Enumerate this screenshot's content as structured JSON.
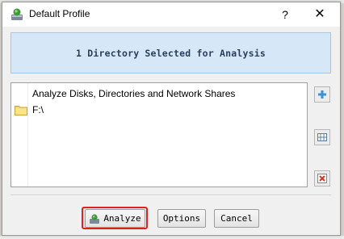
{
  "window": {
    "title": "Default Profile",
    "help_glyph": "?",
    "close_glyph": "✕"
  },
  "banner": {
    "text": "1 Directory Selected for Analysis"
  },
  "list": {
    "header": "Analyze Disks, Directories and Network Shares",
    "items": [
      {
        "label": "F:\\",
        "icon": "folder-icon"
      }
    ]
  },
  "side_buttons": [
    {
      "name": "add-button",
      "icon": "plus-icon"
    },
    {
      "name": "browse-button",
      "icon": "grid-icon"
    },
    {
      "name": "remove-button",
      "icon": "delete-icon"
    }
  ],
  "footer": {
    "analyze_label": "Analyze",
    "options_label": "Options",
    "cancel_label": "Cancel"
  },
  "colors": {
    "banner_bg": "#d6e8f7",
    "banner_text": "#2b3f5c",
    "highlight": "#e0211b"
  }
}
